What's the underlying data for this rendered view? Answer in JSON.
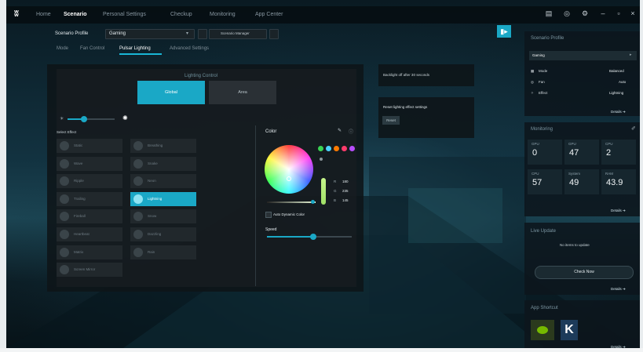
{
  "nav": {
    "logo": "ʬ",
    "items": [
      "Home",
      "Scenario",
      "Personal Settings",
      "Checkup",
      "Monitoring",
      "App Center"
    ],
    "active_index": 1
  },
  "window_controls": {
    "minimize": "–",
    "maximize": "▫",
    "close": "×",
    "icon1": "▤",
    "icon2": "◎",
    "icon3": "⚙"
  },
  "scenario": {
    "profile_label": "Scenario Profile",
    "profile_value": "Gaming",
    "manager_label": "Scenario Manager"
  },
  "tabs": [
    "Mode",
    "Fan Control",
    "Pulsar Lighting",
    "Advanced Settings"
  ],
  "active_tab": 2,
  "lighting": {
    "control_label": "Lighting Control",
    "segments": [
      "Global",
      "Area"
    ],
    "active_segment": 0,
    "brightness_level": 0.35,
    "select_effect_label": "Select Effect",
    "effects_left": [
      "Static",
      "Wave",
      "Ripple",
      "Trailing",
      "Fireball",
      "Heartbeat",
      "Matrix",
      "Screen Mirror"
    ],
    "effects_right": [
      "Breathing",
      "Snake",
      "Neon",
      "Lightning",
      "Snow",
      "Dazzling",
      "Rain"
    ],
    "active_effect": "Lightning",
    "color_label": "Color",
    "rgb": {
      "r_label": "R",
      "r": "180",
      "g_label": "G",
      "g": "235",
      "b_label": "B",
      "b": "145"
    },
    "swatches": [
      "#39d353",
      "#4dd2ff",
      "#ff7a00",
      "#ff3b6b",
      "#b84dff"
    ],
    "auto_dynamic_label": "Auto Dynamic Color",
    "speed_label": "Speed",
    "speed_level": 0.55
  },
  "backlight_notice": "Backlight off after 30 seconds",
  "reset": {
    "label": "Reset lighting effect settings",
    "button": "Reset"
  },
  "right_panel": {
    "scenario_profile_title": "Scenario Profile",
    "profile_value": "Gaming",
    "rows": [
      {
        "label": "Mode",
        "value": "Balanced"
      },
      {
        "label": "Fan",
        "value": "Auto"
      },
      {
        "label": "Effect",
        "value": "Lightning"
      }
    ],
    "details_label": "Details",
    "monitoring_title": "Monitoring",
    "monitor_cells": [
      {
        "name": "GPU",
        "value": "0"
      },
      {
        "name": "GPU",
        "value": "47"
      },
      {
        "name": "CPU",
        "value": "2"
      },
      {
        "name": "CPU",
        "value": "57"
      },
      {
        "name": "System",
        "value": "49"
      },
      {
        "name": "RAM",
        "value": "43.9"
      }
    ],
    "live_update_title": "Live Update",
    "no_items": "No items to update",
    "check_now": "Check Now",
    "app_shortcut_title": "App Shortcut"
  },
  "colors": {
    "accent": "#1aa8c6",
    "bg": "#0c1e26"
  }
}
